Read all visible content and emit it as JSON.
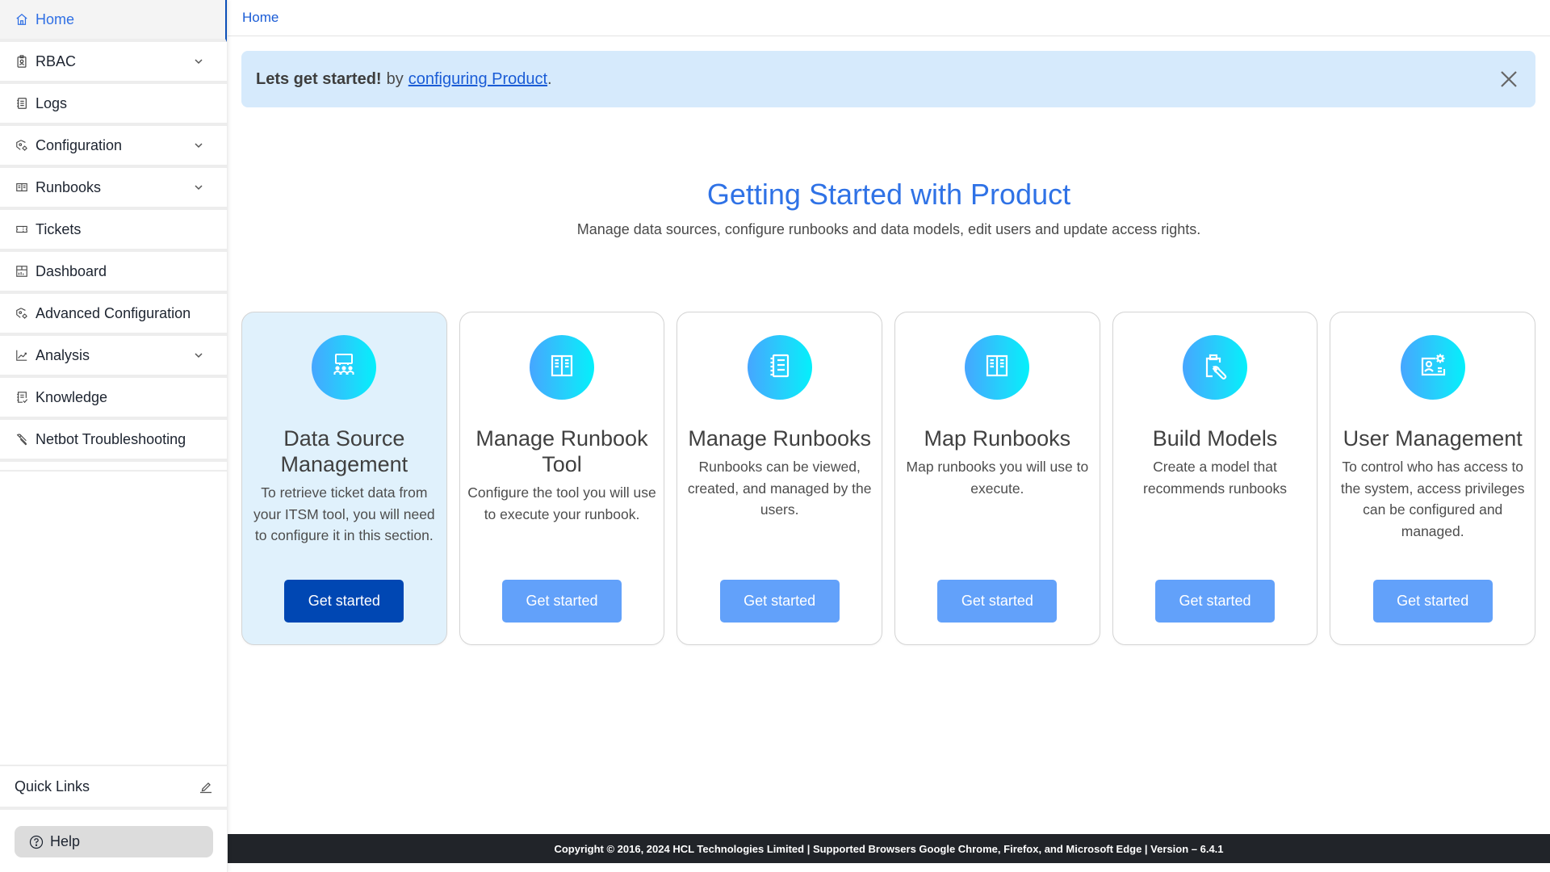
{
  "sidebar": {
    "items": [
      {
        "label": "Home",
        "icon": "home-icon",
        "active": true,
        "expandable": false
      },
      {
        "label": "RBAC",
        "icon": "id-badge-icon",
        "active": false,
        "expandable": true
      },
      {
        "label": "Logs",
        "icon": "notebook-icon",
        "active": false,
        "expandable": false
      },
      {
        "label": "Configuration",
        "icon": "config-gear-icon",
        "active": false,
        "expandable": true
      },
      {
        "label": "Runbooks",
        "icon": "book-open-icon",
        "active": false,
        "expandable": true
      },
      {
        "label": "Tickets",
        "icon": "ticket-icon",
        "active": false,
        "expandable": false
      },
      {
        "label": "Dashboard",
        "icon": "dashboard-icon",
        "active": false,
        "expandable": false
      },
      {
        "label": "Advanced Configuration",
        "icon": "config-gear-icon",
        "active": false,
        "expandable": false
      },
      {
        "label": "Analysis",
        "icon": "chart-line-icon",
        "active": false,
        "expandable": true
      },
      {
        "label": "Knowledge",
        "icon": "knowledge-icon",
        "active": false,
        "expandable": false
      },
      {
        "label": "Netbot Troubleshooting",
        "icon": "wrench-icon",
        "active": false,
        "expandable": false
      }
    ],
    "quick_links_label": "Quick Links",
    "help_label": "Help"
  },
  "header": {
    "breadcrumb": "Home"
  },
  "banner": {
    "strong": "Lets get started!",
    "text": "by",
    "link": "configuring Product",
    "suffix": "."
  },
  "main": {
    "title": "Getting Started with Product",
    "subtitle": "Manage data sources, configure runbooks and data models, edit users and update access rights."
  },
  "cards": [
    {
      "title": "Data Source Management",
      "description": "To retrieve ticket data from your ITSM tool, you will need to configure it in this section.",
      "button": "Get started",
      "icon": "data-source-icon",
      "active": true
    },
    {
      "title": "Manage Runbook Tool",
      "description": "Configure the tool you will use to execute your runbook.",
      "button": "Get started",
      "icon": "book-open-icon",
      "active": false
    },
    {
      "title": "Manage Runbooks",
      "description": "Runbooks can be viewed, created, and managed by the users.",
      "button": "Get started",
      "icon": "notebook-icon",
      "active": false
    },
    {
      "title": "Map Runbooks",
      "description": "Map runbooks you will use to execute.",
      "button": "Get started",
      "icon": "book-open-icon",
      "active": false
    },
    {
      "title": "Build Models",
      "description": "Create a model that recommends runbooks",
      "button": "Get started",
      "icon": "clipboard-wrench-icon",
      "active": false
    },
    {
      "title": "User Management",
      "description": "To control who has access to the system, access privileges can be configured and managed.",
      "button": "Get started",
      "icon": "user-settings-icon",
      "active": false
    }
  ],
  "footer": {
    "text": "Copyright © 2016, 2024 HCL Technologies Limited | Supported Browsers Google Chrome, Firefox, and Microsoft Edge | Version – 6.4.1"
  },
  "colors": {
    "accent": "#2f72e6",
    "primary_button": "#0047b3",
    "secondary_button": "#62a1fa",
    "banner_bg": "#d6eafc",
    "footer_bg": "#212429"
  }
}
